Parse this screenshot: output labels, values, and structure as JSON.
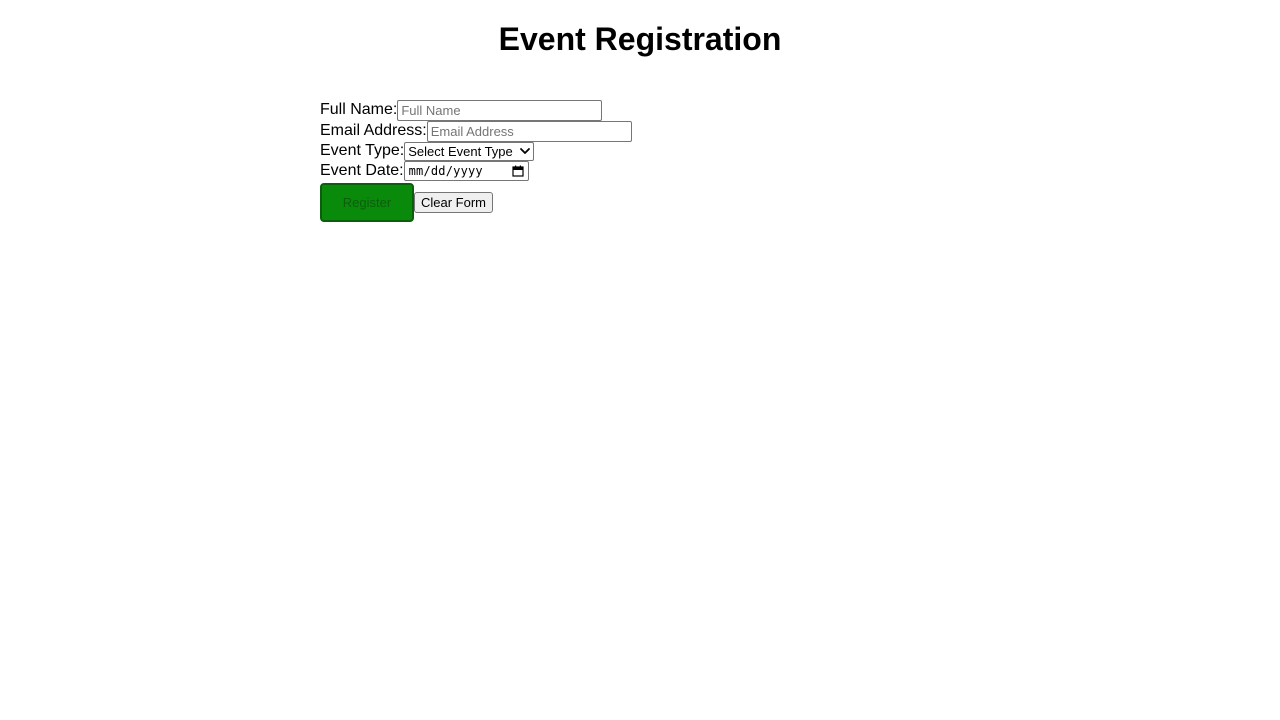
{
  "page": {
    "title": "Event Registration"
  },
  "form": {
    "full_name": {
      "label": "Full Name:",
      "placeholder": "Full Name",
      "value": ""
    },
    "email": {
      "label": "Email Address:",
      "placeholder": "Email Address",
      "value": ""
    },
    "event_type": {
      "label": "Event Type:",
      "selected": "Select Event Type",
      "icon": "chevron-down-icon"
    },
    "event_date": {
      "label": "Event Date:",
      "value": "mm/dd/yyyy",
      "icon": "calendar-icon"
    },
    "register_label": "Register",
    "clear_label": "Clear Form"
  },
  "colors": {
    "register_bg": "#0a8a0a",
    "register_border": "#0b5e0b",
    "register_text": "#0c5e0c"
  }
}
